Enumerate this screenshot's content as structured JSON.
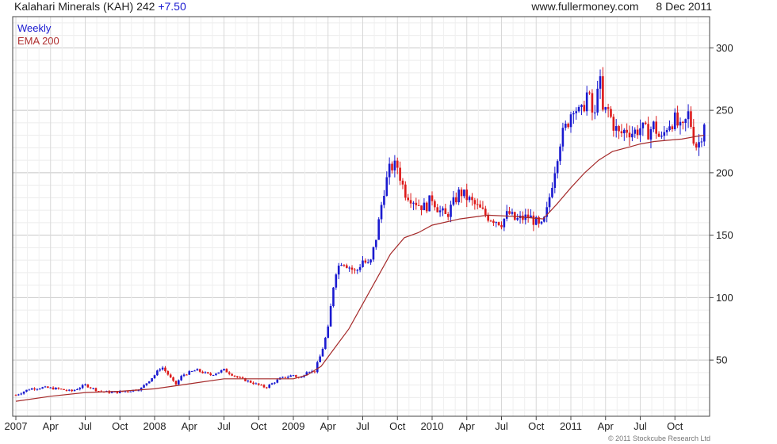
{
  "header": {
    "name": "Kalahari Minerals (KAH)",
    "price": "242",
    "change": "+7.50",
    "site": "www.fullermoney.com",
    "date": "8 Dec 2011"
  },
  "footer": {
    "copyright": "© 2011 Stockcube Research Ltd"
  },
  "colors": {
    "up": "#1a1ad0",
    "down": "#dd1a1a",
    "ema": "#a52a2a",
    "grid": "#d0d0d0",
    "frame": "#444444"
  },
  "chart_data": {
    "type": "candlestick",
    "legend": [
      "Weekly",
      "EMA 200"
    ],
    "legend_position": "top-left",
    "y_axis": {
      "side": "right",
      "ticks": [
        50,
        100,
        150,
        200,
        250,
        300
      ],
      "range": [
        5,
        325
      ]
    },
    "x_axis": {
      "labels": [
        "2007",
        "Apr",
        "Jul",
        "Oct",
        "2008",
        "Apr",
        "Jul",
        "Oct",
        "2009",
        "Apr",
        "Jul",
        "Oct",
        "2010",
        "Apr",
        "Jul",
        "Oct",
        "2011",
        "Apr",
        "Jul",
        "Oct"
      ],
      "range_years": [
        2007.0,
        2011.96
      ]
    },
    "grid": true,
    "close_series": {
      "name": "Weekly",
      "points": [
        [
          2007.0,
          22
        ],
        [
          2007.1,
          27
        ],
        [
          2007.2,
          28
        ],
        [
          2007.3,
          27
        ],
        [
          2007.4,
          25
        ],
        [
          2007.5,
          30
        ],
        [
          2007.6,
          25
        ],
        [
          2007.7,
          24
        ],
        [
          2007.8,
          25
        ],
        [
          2007.9,
          27
        ],
        [
          2008.0,
          38
        ],
        [
          2008.05,
          45
        ],
        [
          2008.1,
          38
        ],
        [
          2008.15,
          30
        ],
        [
          2008.2,
          38
        ],
        [
          2008.3,
          42
        ],
        [
          2008.4,
          38
        ],
        [
          2008.5,
          42
        ],
        [
          2008.6,
          36
        ],
        [
          2008.7,
          32
        ],
        [
          2008.8,
          28
        ],
        [
          2008.9,
          35
        ],
        [
          2009.0,
          38
        ],
        [
          2009.05,
          35
        ],
        [
          2009.1,
          42
        ],
        [
          2009.15,
          40
        ],
        [
          2009.2,
          55
        ],
        [
          2009.25,
          75
        ],
        [
          2009.3,
          120
        ],
        [
          2009.35,
          130
        ],
        [
          2009.4,
          125
        ],
        [
          2009.45,
          120
        ],
        [
          2009.5,
          130
        ],
        [
          2009.55,
          125
        ],
        [
          2009.6,
          150
        ],
        [
          2009.65,
          185
        ],
        [
          2009.7,
          205
        ],
        [
          2009.75,
          205
        ],
        [
          2009.8,
          185
        ],
        [
          2009.85,
          180
        ],
        [
          2009.9,
          175
        ],
        [
          2009.95,
          172
        ],
        [
          2010.0,
          180
        ],
        [
          2010.05,
          170
        ],
        [
          2010.1,
          165
        ],
        [
          2010.2,
          185
        ],
        [
          2010.3,
          175
        ],
        [
          2010.4,
          165
        ],
        [
          2010.5,
          160
        ],
        [
          2010.55,
          168
        ],
        [
          2010.6,
          162
        ],
        [
          2010.7,
          165
        ],
        [
          2010.75,
          160
        ],
        [
          2010.78,
          155
        ],
        [
          2010.82,
          165
        ],
        [
          2010.87,
          195
        ],
        [
          2010.92,
          225
        ],
        [
          2010.97,
          238
        ],
        [
          2011.02,
          255
        ],
        [
          2011.07,
          245
        ],
        [
          2011.12,
          265
        ],
        [
          2011.17,
          240
        ],
        [
          2011.2,
          285
        ],
        [
          2011.23,
          248
        ],
        [
          2011.27,
          250
        ],
        [
          2011.3,
          240
        ],
        [
          2011.35,
          230
        ],
        [
          2011.4,
          235
        ],
        [
          2011.45,
          232
        ],
        [
          2011.5,
          236
        ],
        [
          2011.55,
          232
        ],
        [
          2011.6,
          238
        ],
        [
          2011.65,
          225
        ],
        [
          2011.7,
          240
        ],
        [
          2011.75,
          242
        ],
        [
          2011.8,
          232
        ],
        [
          2011.85,
          248
        ],
        [
          2011.88,
          230
        ],
        [
          2011.91,
          220
        ],
        [
          2011.94,
          230
        ],
        [
          2011.96,
          242
        ]
      ]
    },
    "ema_series": {
      "name": "EMA 200",
      "points": [
        [
          2007.0,
          17
        ],
        [
          2007.25,
          21
        ],
        [
          2007.5,
          24
        ],
        [
          2007.75,
          25
        ],
        [
          2008.0,
          27
        ],
        [
          2008.25,
          31
        ],
        [
          2008.5,
          35
        ],
        [
          2008.75,
          35
        ],
        [
          2009.0,
          35
        ],
        [
          2009.1,
          38
        ],
        [
          2009.2,
          45
        ],
        [
          2009.3,
          60
        ],
        [
          2009.4,
          75
        ],
        [
          2009.5,
          95
        ],
        [
          2009.6,
          115
        ],
        [
          2009.7,
          135
        ],
        [
          2009.8,
          148
        ],
        [
          2009.9,
          152
        ],
        [
          2010.0,
          158
        ],
        [
          2010.2,
          163
        ],
        [
          2010.4,
          166
        ],
        [
          2010.6,
          165
        ],
        [
          2010.8,
          163
        ],
        [
          2010.9,
          175
        ],
        [
          2011.0,
          188
        ],
        [
          2011.1,
          200
        ],
        [
          2011.2,
          210
        ],
        [
          2011.3,
          217
        ],
        [
          2011.4,
          220
        ],
        [
          2011.5,
          223
        ],
        [
          2011.6,
          225
        ],
        [
          2011.7,
          226
        ],
        [
          2011.8,
          227
        ],
        [
          2011.9,
          229
        ],
        [
          2011.96,
          230
        ]
      ]
    }
  }
}
